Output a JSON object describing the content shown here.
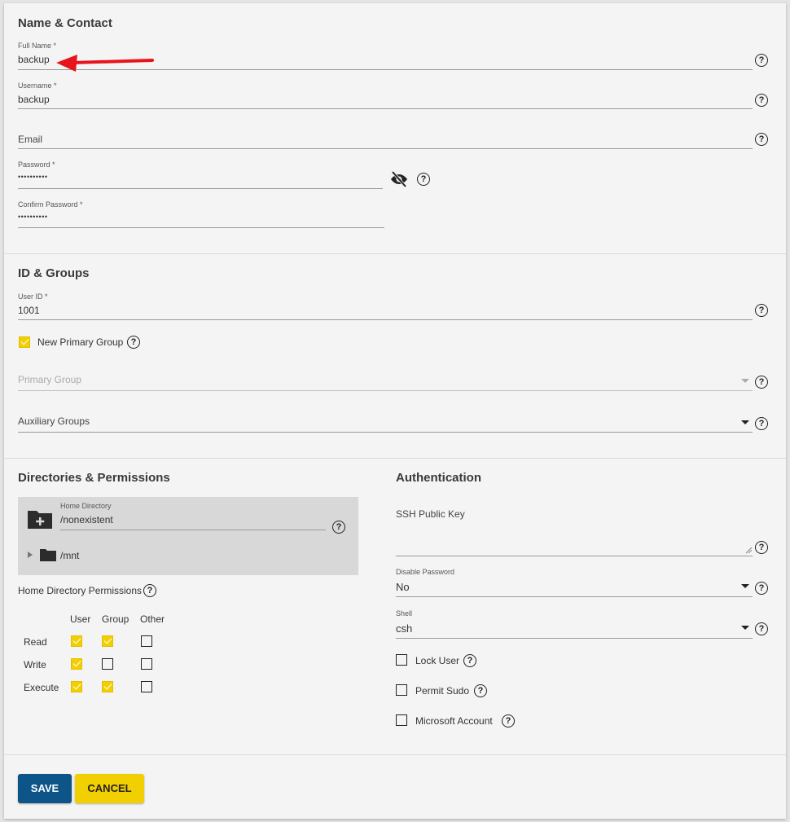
{
  "name_contact": {
    "title": "Name & Contact",
    "full_name": {
      "label": "Full Name *",
      "value": "backup"
    },
    "username": {
      "label": "Username *",
      "value": "backup"
    },
    "email": {
      "label": "Email",
      "value": ""
    },
    "password": {
      "label": "Password *",
      "value": "••••••••••"
    },
    "confirm_password": {
      "label": "Confirm Password *",
      "value": "••••••••••"
    }
  },
  "id_groups": {
    "title": "ID & Groups",
    "user_id": {
      "label": "User ID *",
      "value": "1001"
    },
    "new_primary_group": {
      "label": "New Primary Group",
      "checked": true
    },
    "primary_group": {
      "label": "Primary Group"
    },
    "auxiliary_groups": {
      "label": "Auxiliary Groups"
    }
  },
  "directories": {
    "title": "Directories & Permissions",
    "home_directory": {
      "label": "Home Directory",
      "value": "/nonexistent"
    },
    "tree_item": "/mnt",
    "permissions_label": "Home Directory Permissions",
    "columns": [
      "User",
      "Group",
      "Other"
    ],
    "rows": [
      {
        "label": "Read",
        "values": [
          true,
          true,
          false
        ]
      },
      {
        "label": "Write",
        "values": [
          true,
          false,
          false
        ]
      },
      {
        "label": "Execute",
        "values": [
          true,
          true,
          false
        ]
      }
    ]
  },
  "authentication": {
    "title": "Authentication",
    "ssh_key": {
      "label": "SSH Public Key",
      "value": ""
    },
    "disable_password": {
      "label": "Disable Password",
      "value": "No"
    },
    "shell": {
      "label": "Shell",
      "value": "csh"
    },
    "lock_user": {
      "label": "Lock User",
      "checked": false
    },
    "permit_sudo": {
      "label": "Permit Sudo",
      "checked": false
    },
    "microsoft_account": {
      "label": "Microsoft Account",
      "checked": false
    }
  },
  "actions": {
    "save": "SAVE",
    "cancel": "CANCEL"
  },
  "icons": {
    "help": "?",
    "colors": {
      "primary": "#0d5488",
      "accent": "#f1cf00",
      "annotation_arrow": "#e8141b"
    }
  }
}
